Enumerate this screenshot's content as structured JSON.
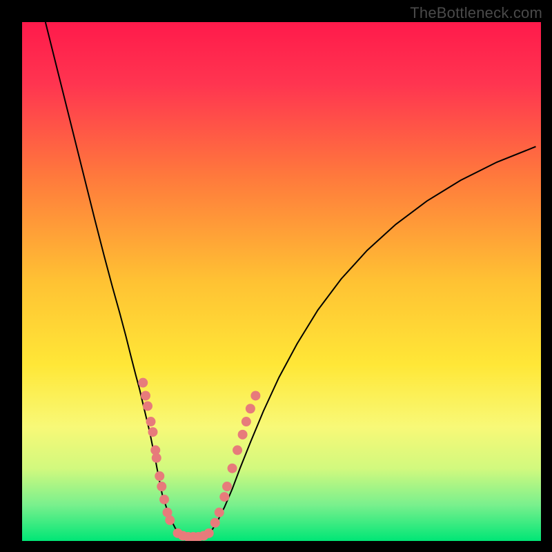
{
  "watermark": "TheBottleneck.com",
  "chart_data": {
    "type": "line",
    "title": "",
    "xlabel": "",
    "ylabel": "",
    "xlim": [
      0,
      100
    ],
    "ylim": [
      0,
      100
    ],
    "grid": false,
    "legend": false,
    "gradient_stops": [
      {
        "offset": 0.0,
        "color": "#ff1a4b"
      },
      {
        "offset": 0.12,
        "color": "#ff3550"
      },
      {
        "offset": 0.3,
        "color": "#ff7a3c"
      },
      {
        "offset": 0.5,
        "color": "#ffc233"
      },
      {
        "offset": 0.66,
        "color": "#ffe737"
      },
      {
        "offset": 0.78,
        "color": "#f8f977"
      },
      {
        "offset": 0.86,
        "color": "#d2f97e"
      },
      {
        "offset": 0.93,
        "color": "#7af08d"
      },
      {
        "offset": 1.0,
        "color": "#00e676"
      }
    ],
    "series": [
      {
        "name": "curve-left",
        "x": [
          4.5,
          7.0,
          9.5,
          12.0,
          14.0,
          15.8,
          17.4,
          18.8,
          20.0,
          21.0,
          21.9,
          22.7,
          23.4,
          24.0,
          24.6,
          25.1,
          25.6,
          26.0,
          26.5,
          27.0,
          27.8,
          28.5,
          29.5,
          30.5
        ],
        "y": [
          100.0,
          90.0,
          80.0,
          70.0,
          62.0,
          55.0,
          49.0,
          44.0,
          39.5,
          35.5,
          32.0,
          29.0,
          26.0,
          23.5,
          21.0,
          18.5,
          16.2,
          14.0,
          11.5,
          9.0,
          6.5,
          4.5,
          2.5,
          1.2
        ]
      },
      {
        "name": "curve-bottom",
        "x": [
          30.5,
          31.5,
          33.0,
          35.0,
          36.0
        ],
        "y": [
          1.2,
          0.8,
          0.6,
          0.8,
          1.2
        ]
      },
      {
        "name": "curve-right",
        "x": [
          36.0,
          37.5,
          39.0,
          40.5,
          42.0,
          44.0,
          46.5,
          49.5,
          53.0,
          57.0,
          61.5,
          66.5,
          72.0,
          78.0,
          84.5,
          91.5,
          99.0
        ],
        "y": [
          1.2,
          3.5,
          6.5,
          10.0,
          14.0,
          19.0,
          25.0,
          31.5,
          38.0,
          44.5,
          50.5,
          56.0,
          61.0,
          65.5,
          69.5,
          73.0,
          76.0
        ]
      }
    ],
    "markers": {
      "name": "data-points",
      "color": "#e77b7b",
      "radius_px": 7,
      "points": [
        {
          "x": 23.3,
          "y": 30.5
        },
        {
          "x": 23.8,
          "y": 28.0
        },
        {
          "x": 24.2,
          "y": 26.0
        },
        {
          "x": 24.8,
          "y": 23.0
        },
        {
          "x": 25.2,
          "y": 21.0
        },
        {
          "x": 25.7,
          "y": 17.5
        },
        {
          "x": 25.9,
          "y": 16.0
        },
        {
          "x": 26.5,
          "y": 12.5
        },
        {
          "x": 26.9,
          "y": 10.5
        },
        {
          "x": 27.4,
          "y": 8.0
        },
        {
          "x": 28.0,
          "y": 5.5
        },
        {
          "x": 28.5,
          "y": 4.0
        },
        {
          "x": 30.0,
          "y": 1.5
        },
        {
          "x": 31.0,
          "y": 1.0
        },
        {
          "x": 32.0,
          "y": 0.8
        },
        {
          "x": 33.0,
          "y": 0.8
        },
        {
          "x": 34.0,
          "y": 0.8
        },
        {
          "x": 35.0,
          "y": 1.0
        },
        {
          "x": 36.0,
          "y": 1.5
        },
        {
          "x": 37.2,
          "y": 3.5
        },
        {
          "x": 38.0,
          "y": 5.5
        },
        {
          "x": 39.0,
          "y": 8.5
        },
        {
          "x": 39.5,
          "y": 10.5
        },
        {
          "x": 40.5,
          "y": 14.0
        },
        {
          "x": 41.5,
          "y": 17.5
        },
        {
          "x": 42.5,
          "y": 20.5
        },
        {
          "x": 43.2,
          "y": 23.0
        },
        {
          "x": 44.0,
          "y": 25.5
        },
        {
          "x": 45.0,
          "y": 28.0
        }
      ]
    }
  }
}
